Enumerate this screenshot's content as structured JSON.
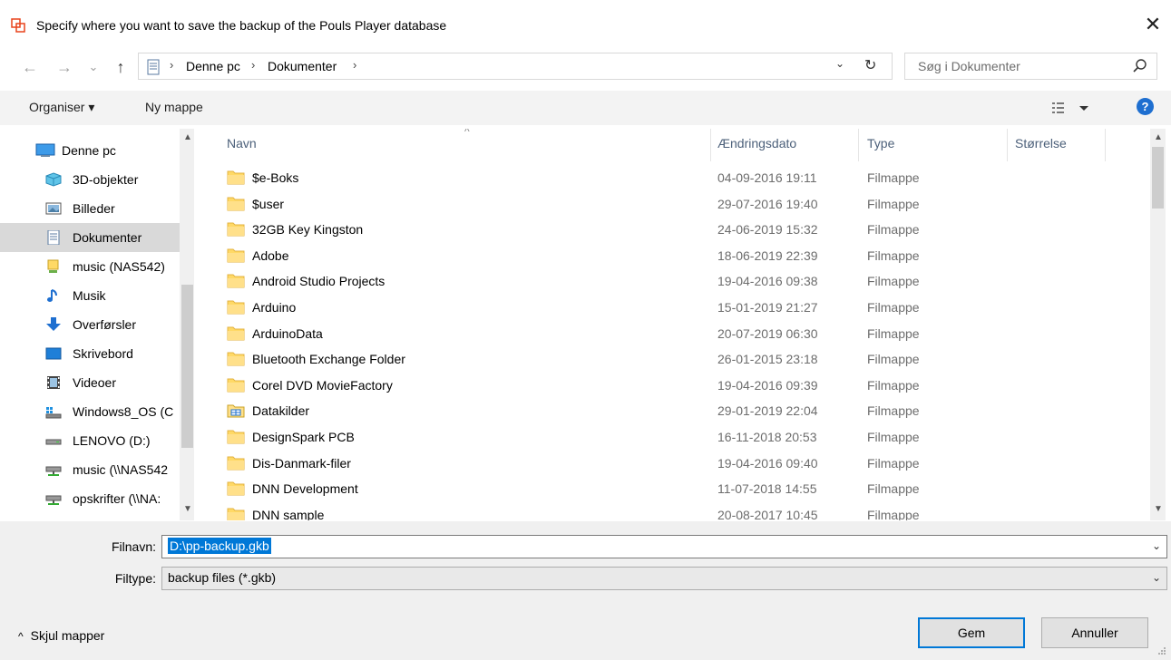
{
  "window": {
    "title": "Specify where you want to save the backup of the Pouls Player database",
    "close_glyph": "✕",
    "accent": "#0078d7"
  },
  "nav": {
    "back_glyph": "←",
    "forward_glyph": "→",
    "recent_glyph": "⌄",
    "up_glyph": "↑",
    "breadcrumbs": [
      "Denne pc",
      "Dokumenter"
    ],
    "crumb_separator": "›",
    "dropdown_glyph": "⌄",
    "refresh_glyph": "↻",
    "search_placeholder": "Søg i Dokumenter"
  },
  "toolbar": {
    "organize_label": "Organiser ▾",
    "new_folder_label": "Ny mappe",
    "help_label": "?"
  },
  "sidebar": {
    "items": [
      {
        "label": "Denne pc",
        "icon": "computer-icon",
        "selected": false
      },
      {
        "label": "3D-objekter",
        "icon": "cube-icon",
        "selected": false
      },
      {
        "label": "Billeder",
        "icon": "pictures-icon",
        "selected": false
      },
      {
        "label": "Dokumenter",
        "icon": "documents-icon",
        "selected": true
      },
      {
        "label": "music (NAS542)",
        "icon": "network-folder-icon",
        "selected": false
      },
      {
        "label": "Musik",
        "icon": "music-note-icon",
        "selected": false
      },
      {
        "label": "Overførsler",
        "icon": "download-arrow-icon",
        "selected": false
      },
      {
        "label": "Skrivebord",
        "icon": "desktop-icon",
        "selected": false
      },
      {
        "label": "Videoer",
        "icon": "film-icon",
        "selected": false
      },
      {
        "label": "Windows8_OS (C",
        "icon": "windows-drive-icon",
        "selected": false
      },
      {
        "label": "LENOVO (D:)",
        "icon": "drive-icon",
        "selected": false
      },
      {
        "label": "music (\\\\NAS542",
        "icon": "network-drive-icon",
        "selected": false
      },
      {
        "label": "opskrifter (\\\\NA:",
        "icon": "network-drive-icon",
        "selected": false
      }
    ]
  },
  "filelist": {
    "columns": {
      "name": "Navn",
      "date": "Ændringsdato",
      "type": "Type",
      "size": "Størrelse"
    },
    "sort_glyph": "^",
    "rows": [
      {
        "name": "$e-Boks",
        "date": "04-09-2016 19:11",
        "type": "Filmappe",
        "icon": "folder-icon"
      },
      {
        "name": "$user",
        "date": "29-07-2016 19:40",
        "type": "Filmappe",
        "icon": "folder-icon"
      },
      {
        "name": "32GB Key Kingston",
        "date": "24-06-2019 15:32",
        "type": "Filmappe",
        "icon": "folder-icon"
      },
      {
        "name": "Adobe",
        "date": "18-06-2019 22:39",
        "type": "Filmappe",
        "icon": "folder-icon"
      },
      {
        "name": "Android Studio Projects",
        "date": "19-04-2016 09:38",
        "type": "Filmappe",
        "icon": "folder-icon"
      },
      {
        "name": "Arduino",
        "date": "15-01-2019 21:27",
        "type": "Filmappe",
        "icon": "folder-icon"
      },
      {
        "name": "ArduinoData",
        "date": "20-07-2019 06:30",
        "type": "Filmappe",
        "icon": "folder-icon"
      },
      {
        "name": "Bluetooth Exchange Folder",
        "date": "26-01-2015 23:18",
        "type": "Filmappe",
        "icon": "folder-icon"
      },
      {
        "name": "Corel DVD MovieFactory",
        "date": "19-04-2016 09:39",
        "type": "Filmappe",
        "icon": "folder-icon"
      },
      {
        "name": "Datakilder",
        "date": "29-01-2019 22:04",
        "type": "Filmappe",
        "icon": "datasource-folder-icon"
      },
      {
        "name": "DesignSpark PCB",
        "date": "16-11-2018 20:53",
        "type": "Filmappe",
        "icon": "folder-icon"
      },
      {
        "name": "Dis-Danmark-filer",
        "date": "19-04-2016 09:40",
        "type": "Filmappe",
        "icon": "folder-icon"
      },
      {
        "name": "DNN Development",
        "date": "11-07-2018 14:55",
        "type": "Filmappe",
        "icon": "folder-icon"
      },
      {
        "name": "DNN sample",
        "date": "20-08-2017 10:45",
        "type": "Filmappe",
        "icon": "folder-icon"
      }
    ]
  },
  "form": {
    "filename_label": "Filnavn:",
    "filename_value": "D:\\pp-backup.gkb",
    "filetype_label": "Filtype:",
    "filetype_value": "backup files (*.gkb)",
    "dropdown_glyph": "⌄"
  },
  "footer": {
    "hide_folders_label": "Skjul mapper",
    "hide_folders_glyph": "^",
    "save_label": "Gem",
    "cancel_label": "Annuller"
  }
}
